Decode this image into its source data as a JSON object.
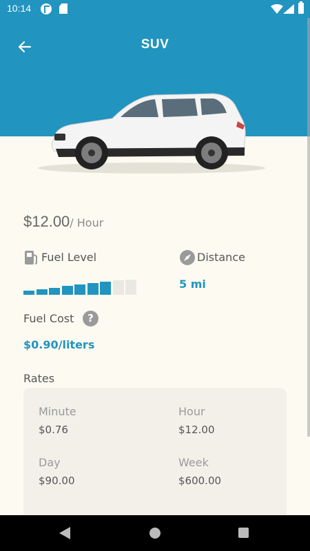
{
  "status_bar": {
    "time": "10:14"
  },
  "app_bar": {
    "title": "SUV",
    "back_icon": "arrow-left-icon"
  },
  "vehicle": {
    "price": "$12.00",
    "price_unit": "/ Hour",
    "fuel_level_label": "Fuel Level",
    "fuel_level_bars_filled": 7,
    "fuel_level_bars_total": 9,
    "distance_label": "Distance",
    "distance_value": "5 mi",
    "fuel_cost_label": "Fuel Cost",
    "fuel_cost_value": "$0.90/liters"
  },
  "rates": {
    "title": "Rates",
    "items": [
      {
        "label": "Minute",
        "value": "$0.76"
      },
      {
        "label": "Hour",
        "value": "$12.00"
      },
      {
        "label": "Day",
        "value": "$90.00"
      },
      {
        "label": "Week",
        "value": "$600.00"
      }
    ]
  },
  "colors": {
    "accent": "#2194bf",
    "background": "#fdfbf1",
    "card": "#f2f0e9",
    "bar_empty": "#e9e8e1"
  }
}
